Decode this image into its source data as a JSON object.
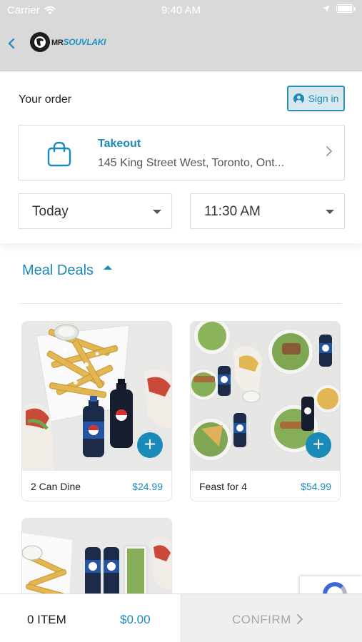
{
  "status_bar": {
    "carrier": "Carrier",
    "time": "9:40 AM",
    "icons": [
      "wifi-icon",
      "location-arrow-icon",
      "battery-icon"
    ]
  },
  "header": {
    "back_icon": "chevron-left-icon",
    "logo_mr": "MR",
    "logo_brand": "SOUVLAKI"
  },
  "order": {
    "title": "Your order",
    "sign_in_label": "Sign in",
    "fulfillment": {
      "type": "Takeout",
      "address": "145 King Street West, Toronto, Ont..."
    },
    "day": "Today",
    "time": "11:30 AM"
  },
  "category": {
    "title": "Meal Deals",
    "expanded": true
  },
  "products": [
    {
      "name": "2 Can Dine",
      "price": "$24.99"
    },
    {
      "name": "Feast for 4",
      "price": "$54.99"
    },
    {
      "name": "",
      "price": ""
    }
  ],
  "cart": {
    "items_label": "0 ITEM",
    "total": "$0.00",
    "confirm_label": "CONFIRM"
  },
  "colors": {
    "accent": "#1a8ab8",
    "header_bg": "#d9d9d9",
    "confirm_bg": "#efefef"
  }
}
